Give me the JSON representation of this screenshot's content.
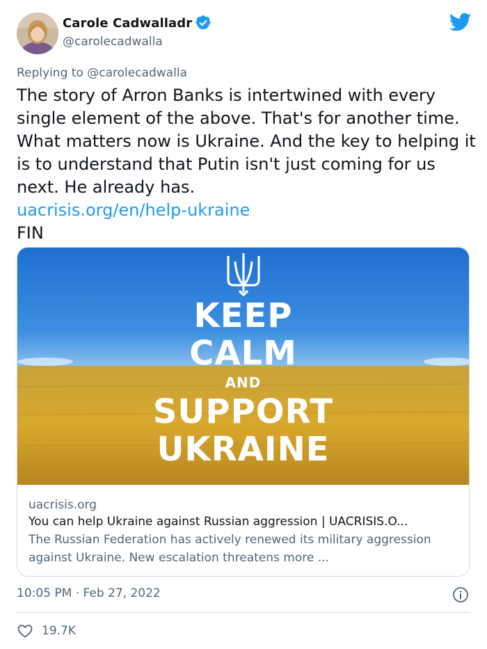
{
  "author": {
    "name": "Carole Cadwalladr",
    "handle": "@carolecadwalla"
  },
  "reply": {
    "prefix": "Replying to ",
    "mention": "@carolecadwalla"
  },
  "tweet": {
    "text": "The story of Arron Banks is intertwined with every single element of the above. That's for another time. What matters now is Ukraine. And the key to helping it is to understand that Putin isn't just coming for us next. He already has.",
    "link": "uacrisis.org/en/help-ukraine",
    "closing": "FIN"
  },
  "card": {
    "poster": {
      "line1": "KEEP",
      "line2": "CALM",
      "line3": "AND",
      "line4": "SUPPORT",
      "line5": "UKRAINE"
    },
    "domain": "uacrisis.org",
    "title": "You can help Ukraine against Russian aggression | UACRISIS.O...",
    "description": "The Russian Federation has actively renewed its military aggression against Ukraine. New escalation threatens more ..."
  },
  "meta": {
    "timestamp": "10:05 PM · Feb 27, 2022",
    "likes": "19.7K"
  },
  "colors": {
    "link": "#1d9bf0",
    "secondary_text": "#536471",
    "sky": "#2f7fd6",
    "wheat": "#d9a62a"
  },
  "icons": [
    "verified-badge-icon",
    "twitter-bird-icon",
    "info-icon",
    "heart-icon",
    "trident-icon"
  ]
}
